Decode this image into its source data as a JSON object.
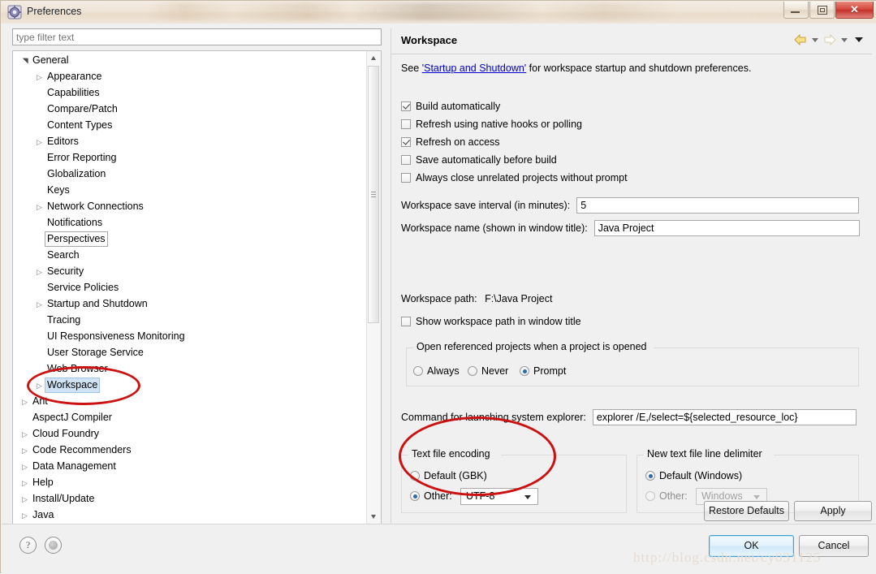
{
  "window": {
    "title": "Preferences",
    "icon": "preferences-gear-icon",
    "buttons": {
      "minimize": "minimize-icon",
      "restore": "restore-icon",
      "close": "✕"
    }
  },
  "filter": {
    "placeholder": "type filter text",
    "value": ""
  },
  "tree": {
    "items": [
      {
        "label": "General",
        "level": 1,
        "arrow": "expanded"
      },
      {
        "label": "Appearance",
        "level": 2,
        "arrow": "collapsed"
      },
      {
        "label": "Capabilities",
        "level": 2,
        "arrow": "none"
      },
      {
        "label": "Compare/Patch",
        "level": 2,
        "arrow": "none"
      },
      {
        "label": "Content Types",
        "level": 2,
        "arrow": "none"
      },
      {
        "label": "Editors",
        "level": 2,
        "arrow": "collapsed"
      },
      {
        "label": "Error Reporting",
        "level": 2,
        "arrow": "none"
      },
      {
        "label": "Globalization",
        "level": 2,
        "arrow": "none"
      },
      {
        "label": "Keys",
        "level": 2,
        "arrow": "none"
      },
      {
        "label": "Network Connections",
        "level": 2,
        "arrow": "collapsed"
      },
      {
        "label": "Notifications",
        "level": 2,
        "arrow": "none"
      },
      {
        "label": "Perspectives",
        "level": 2,
        "arrow": "none",
        "focused": true
      },
      {
        "label": "Search",
        "level": 2,
        "arrow": "none"
      },
      {
        "label": "Security",
        "level": 2,
        "arrow": "collapsed"
      },
      {
        "label": "Service Policies",
        "level": 2,
        "arrow": "none"
      },
      {
        "label": "Startup and Shutdown",
        "level": 2,
        "arrow": "collapsed"
      },
      {
        "label": "Tracing",
        "level": 2,
        "arrow": "none"
      },
      {
        "label": "UI Responsiveness Monitoring",
        "level": 2,
        "arrow": "none"
      },
      {
        "label": "User Storage Service",
        "level": 2,
        "arrow": "none"
      },
      {
        "label": "Web Browser",
        "level": 2,
        "arrow": "none"
      },
      {
        "label": "Workspace",
        "level": 2,
        "arrow": "collapsed",
        "selected": true
      },
      {
        "label": "Ant",
        "level": 1,
        "arrow": "collapsed"
      },
      {
        "label": "AspectJ Compiler",
        "level": 1,
        "arrow": "none"
      },
      {
        "label": "Cloud Foundry",
        "level": 1,
        "arrow": "collapsed"
      },
      {
        "label": "Code Recommenders",
        "level": 1,
        "arrow": "collapsed"
      },
      {
        "label": "Data Management",
        "level": 1,
        "arrow": "collapsed"
      },
      {
        "label": "Help",
        "level": 1,
        "arrow": "collapsed"
      },
      {
        "label": "Install/Update",
        "level": 1,
        "arrow": "collapsed"
      },
      {
        "label": "Java",
        "level": 1,
        "arrow": "collapsed"
      }
    ]
  },
  "page": {
    "title": "Workspace",
    "nav": {
      "back": "back-arrow-icon",
      "forward": "forward-arrow-icon",
      "menu": "view-menu-icon"
    },
    "intro": {
      "prefix": "See ",
      "link": "'Startup and Shutdown'",
      "suffix": " for workspace startup and shutdown preferences."
    },
    "checkboxes": [
      {
        "label": "Build automatically",
        "checked": true
      },
      {
        "label": "Refresh using native hooks or polling",
        "checked": false
      },
      {
        "label": "Refresh on access",
        "checked": true
      },
      {
        "label": "Save automatically before build",
        "checked": false
      },
      {
        "label": "Always close unrelated projects without prompt",
        "checked": false
      }
    ],
    "save_interval": {
      "label": "Workspace save interval (in minutes):",
      "value": "5"
    },
    "workspace_name": {
      "label": "Workspace name (shown in window title):",
      "value": "Java Project"
    },
    "workspace_path": {
      "label": "Workspace path:",
      "value": "F:\\Java Project"
    },
    "show_path_checkbox": {
      "label": "Show workspace path in window title",
      "checked": false
    },
    "referenced_projects": {
      "title": "Open referenced projects when a project is opened",
      "options": [
        {
          "label": "Always",
          "checked": false
        },
        {
          "label": "Never",
          "checked": false
        },
        {
          "label": "Prompt",
          "checked": true
        }
      ]
    },
    "explorer_command": {
      "label": "Command for launching system explorer:",
      "value": "explorer /E,/select=${selected_resource_loc}"
    },
    "text_file_encoding": {
      "title": "Text file encoding",
      "default_option": {
        "label": "Default (GBK)",
        "checked": false
      },
      "other_option": {
        "label": "Other:",
        "checked": true
      },
      "combo_value": "UTF-8"
    },
    "line_delimiter": {
      "title": "New text file line delimiter",
      "default_option": {
        "label": "Default (Windows)",
        "checked": true
      },
      "other_option": {
        "label": "Other:",
        "checked": false
      },
      "combo_value": "Windows"
    },
    "restore_defaults_button": "Restore Defaults",
    "apply_button": "Apply"
  },
  "footer": {
    "help_icon": "?",
    "secondary_icon": "disc-icon",
    "ok_button": "OK",
    "cancel_button": "Cancel"
  },
  "watermark": "http://blog.csdn.net/cy031125",
  "colors": {
    "accent": "#2b6ca8",
    "link": "#0000cc",
    "annotation": "#cc1111",
    "close_button": "#d4453a"
  }
}
